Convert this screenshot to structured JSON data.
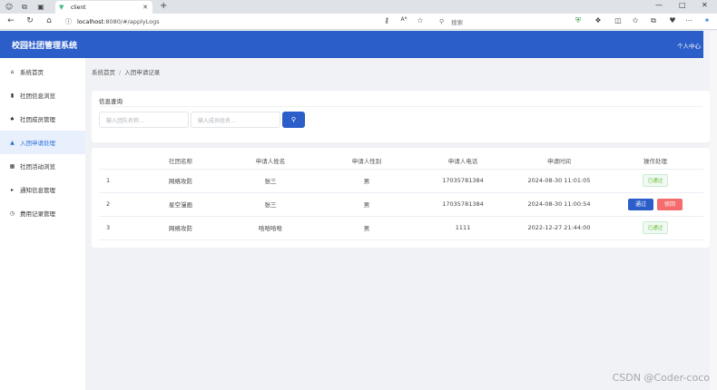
{
  "browser": {
    "tab_title": "client",
    "url_host": "localhost",
    "url_rest": ":8080/#/applyLogs",
    "search_placeholder": "搜索"
  },
  "header": {
    "title": "校园社团管理系统",
    "user_center": "个人中心"
  },
  "sidebar": {
    "items": [
      {
        "label": "系统首页",
        "icon": "home-icon"
      },
      {
        "label": "社团信息浏览",
        "icon": "phone-icon"
      },
      {
        "label": "社团成员管理",
        "icon": "group-icon"
      },
      {
        "label": "入团申请处理",
        "icon": "inbox-icon",
        "active": true
      },
      {
        "label": "社团活动浏览",
        "icon": "calendar-icon"
      },
      {
        "label": "通知信息管理",
        "icon": "megaphone-icon"
      },
      {
        "label": "费用记录管理",
        "icon": "clock-icon"
      }
    ]
  },
  "breadcrumb": {
    "home": "系统首页",
    "separator": "/",
    "current": "入团申请记录"
  },
  "query": {
    "title": "信息查询",
    "club_placeholder": "输入团队名称...",
    "member_placeholder": "输入成员姓名..."
  },
  "table": {
    "headers": [
      "",
      "社团名称",
      "申请人姓名",
      "申请人性别",
      "申请人电话",
      "申请时间",
      "操作处理"
    ],
    "rows": [
      {
        "idx": "1",
        "club": "网络攻防",
        "name": "张三",
        "gender": "男",
        "phone": "17035781384",
        "time": "2024-08-30 11:01:05",
        "status": "已通过"
      },
      {
        "idx": "2",
        "club": "星空漫画",
        "name": "张三",
        "gender": "男",
        "phone": "17035781384",
        "time": "2024-08-30 11:00:54",
        "pass": "通过",
        "reject": "驳回"
      },
      {
        "idx": "3",
        "club": "网络攻防",
        "name": "哈哈哈哈",
        "gender": "男",
        "phone": "1111",
        "time": "2022-12-27 21:44:00",
        "status": "已通过"
      }
    ]
  },
  "watermark": "CSDN @Coder-coco",
  "colors": {
    "primary": "#2c5ec9",
    "danger": "#f56c6c",
    "success": "#67c23a"
  }
}
